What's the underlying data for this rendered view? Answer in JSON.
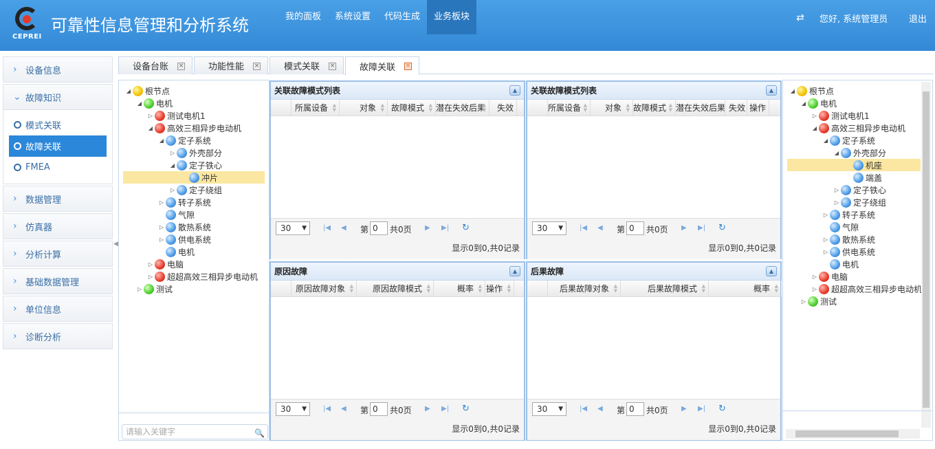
{
  "header": {
    "logo_text": "CEPREI",
    "app_title": "可靠性信息管理和分析系统",
    "nav": [
      "我的面板",
      "系统设置",
      "代码生成",
      "业务板块"
    ],
    "active_nav": "业务板块",
    "greeting": "您好, 系统管理员",
    "logout": "退出"
  },
  "sidebar": {
    "items": [
      {
        "label": "设备信息"
      },
      {
        "label": "故障知识",
        "expanded": true,
        "children": [
          "模式关联",
          "故障关联",
          "FMEA"
        ],
        "active_child": "故障关联"
      },
      {
        "label": "数据管理"
      },
      {
        "label": "仿真器"
      },
      {
        "label": "分析计算"
      },
      {
        "label": "基础数据管理"
      },
      {
        "label": "单位信息"
      },
      {
        "label": "诊断分析"
      }
    ]
  },
  "tabs": [
    "设备台账",
    "功能性能",
    "模式关联",
    "故障关联"
  ],
  "active_tab": "故障关联",
  "left_tree": {
    "nodes": [
      "根节点",
      "电机",
      "测试电机1",
      "高效三相异步电动机",
      "定子系统",
      "外壳部分",
      "定子铁心",
      "冲片",
      "定子绕组",
      "转子系统",
      "气隙",
      "散热系统",
      "供电系统",
      "电机",
      "电脑",
      "超超高效三相异步电动机",
      "测试"
    ],
    "selected": "冲片",
    "search_placeholder": "请输入关键字"
  },
  "right_tree": {
    "nodes": [
      "根节点",
      "电机",
      "测试电机1",
      "高效三相异步电动机",
      "定子系统",
      "外壳部分",
      "机座",
      "端盖",
      "定子铁心",
      "定子绕组",
      "转子系统",
      "气隙",
      "散热系统",
      "供电系统",
      "电机",
      "电脑",
      "超超高效三相异步电动机",
      "测试"
    ],
    "selected": "机座"
  },
  "grids": {
    "g1": {
      "title": "关联故障模式列表",
      "columns": [
        "所属设备",
        "对象",
        "故障模式",
        "潜在失效后果",
        "失效"
      ]
    },
    "g2": {
      "title": "关联故障模式列表",
      "columns": [
        "所属设备",
        "对象",
        "故障模式",
        "潜在失效后果",
        "失效",
        "操作"
      ]
    },
    "g3": {
      "title": "原因故障",
      "columns": [
        "原因故障对象",
        "原因故障模式",
        "概率",
        "操作"
      ]
    },
    "g4": {
      "title": "后果故障",
      "columns": [
        "后果故障对象",
        "后果故障模式",
        "概率"
      ]
    }
  },
  "pager": {
    "page_size": "30",
    "page_prefix": "第",
    "page_value": "0",
    "page_total": "共0页",
    "info": "显示0到0,共0记录"
  }
}
